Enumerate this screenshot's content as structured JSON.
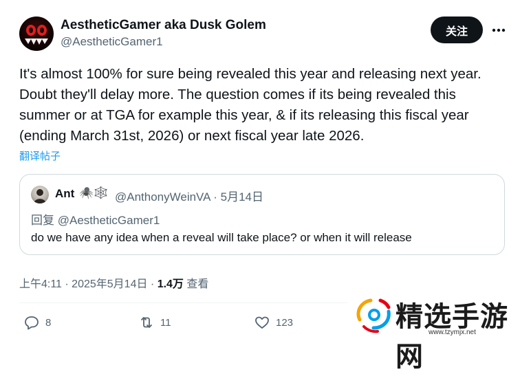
{
  "author": {
    "name": "AestheticGamer aka Dusk Golem",
    "handle": "@AestheticGamer1"
  },
  "follow_label": "关注",
  "more_label": "•••",
  "tweet": {
    "lines": [
      "It's almost 100% for sure being revealed this year and releasing next year.",
      "Doubt they'll delay more. The question comes if its being revealed this",
      "summer or at TGA for example this year, & if its releasing this fiscal year",
      "(ending March 31st, 2026) or next fiscal year late 2026."
    ],
    "translate_label": "翻译帖子"
  },
  "quote": {
    "name": "Ant",
    "name_icons": "🕷️🕸️",
    "handle_date": "@AnthonyWeinVA · 5月14日",
    "reply_to": "回复 @AestheticGamer1",
    "text": "do we have any idea when a reveal will take place? or when it will release"
  },
  "meta": {
    "timestamp": "上午4:11 · 2025年5月14日 · ",
    "views_count": "1.4万",
    "views_label": " 查看"
  },
  "actions": {
    "replies": "8",
    "reposts": "11",
    "likes": "123"
  },
  "watermark": {
    "text": "精选手游网",
    "url": "www.tzymjx.net"
  },
  "colors": {
    "text": "#0f1419",
    "secondary": "#536471",
    "link": "#1d9bf0",
    "border": "#cfd9de",
    "button": "#0f1419"
  }
}
